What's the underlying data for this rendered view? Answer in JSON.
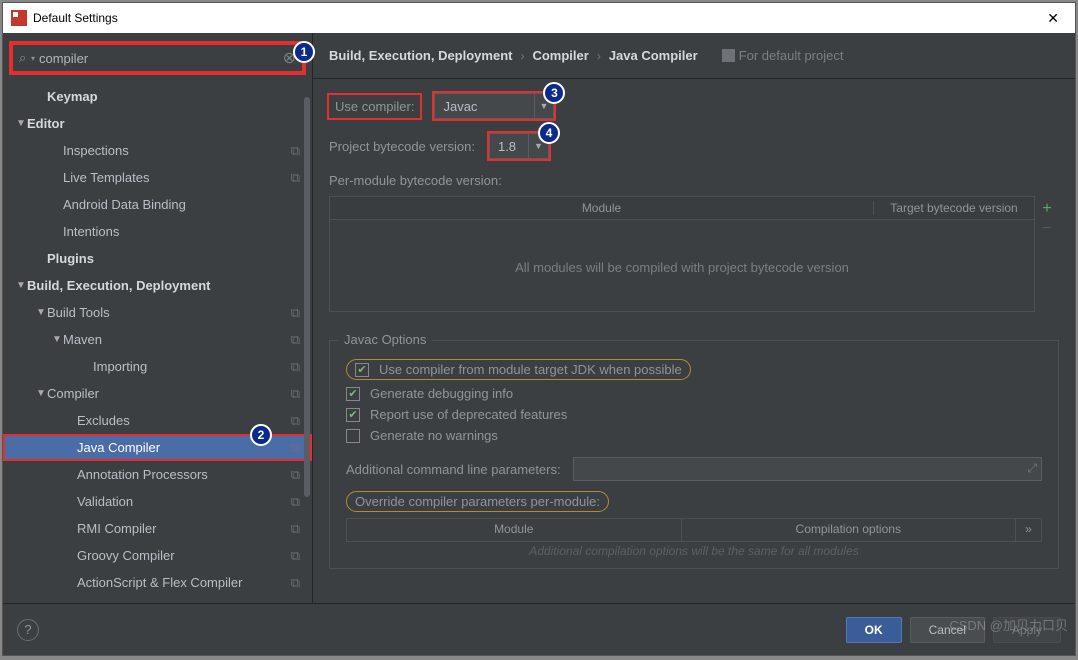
{
  "window": {
    "title": "Default Settings"
  },
  "search": {
    "value": "compiler"
  },
  "annotations": {
    "b1": "1",
    "b2": "2",
    "b3": "3",
    "b4": "4"
  },
  "sidebar": {
    "items": [
      {
        "label": "Keymap",
        "indent": 32,
        "bold": true,
        "arrow": ""
      },
      {
        "label": "Editor",
        "indent": 12,
        "bold": true,
        "arrow": "▼"
      },
      {
        "label": "Inspections",
        "indent": 48,
        "arrow": "",
        "copy": true
      },
      {
        "label": "Live Templates",
        "indent": 48,
        "arrow": "",
        "copy": true
      },
      {
        "label": "Android Data Binding",
        "indent": 48,
        "arrow": ""
      },
      {
        "label": "Intentions",
        "indent": 48,
        "arrow": ""
      },
      {
        "label": "Plugins",
        "indent": 32,
        "bold": true,
        "arrow": ""
      },
      {
        "label": "Build, Execution, Deployment",
        "indent": 12,
        "bold": true,
        "arrow": "▼"
      },
      {
        "label": "Build Tools",
        "indent": 32,
        "arrow": "▼",
        "copy": true
      },
      {
        "label": "Maven",
        "indent": 48,
        "arrow": "▼",
        "copy": true
      },
      {
        "label": "Importing",
        "indent": 78,
        "arrow": "",
        "copy": true
      },
      {
        "label": "Compiler",
        "indent": 32,
        "arrow": "▼",
        "copy": true
      },
      {
        "label": "Excludes",
        "indent": 62,
        "arrow": "",
        "copy": true
      },
      {
        "label": "Java Compiler",
        "indent": 62,
        "arrow": "",
        "copy": true,
        "selected": true,
        "redbox": true
      },
      {
        "label": "Annotation Processors",
        "indent": 62,
        "arrow": "",
        "copy": true
      },
      {
        "label": "Validation",
        "indent": 62,
        "arrow": "",
        "copy": true
      },
      {
        "label": "RMI Compiler",
        "indent": 62,
        "arrow": "",
        "copy": true
      },
      {
        "label": "Groovy Compiler",
        "indent": 62,
        "arrow": "",
        "copy": true
      },
      {
        "label": "ActionScript & Flex Compiler",
        "indent": 62,
        "arrow": "",
        "copy": true
      }
    ]
  },
  "breadcrumb": {
    "a": "Build, Execution, Deployment",
    "b": "Compiler",
    "c": "Java Compiler",
    "fordefault": "For default project"
  },
  "form": {
    "useCompilerLabel": "Use compiler:",
    "useCompilerValue": "Javac",
    "bytecodeLabel": "Project bytecode version:",
    "bytecodeValue": "1.8",
    "perModuleLabel": "Per-module bytecode version:",
    "tableCol1": "Module",
    "tableCol2": "Target bytecode version",
    "tablePlaceholder": "All modules will be compiled with project bytecode version",
    "javacLegend": "Javac Options",
    "chk1": "Use compiler from module target JDK when possible",
    "chk2": "Generate debugging info",
    "chk3": "Report use of deprecated features",
    "chk4": "Generate no warnings",
    "addlLabel": "Additional command line parameters:",
    "overrideLabel": "Override compiler parameters per-module:",
    "subCol1": "Module",
    "subCol2": "Compilation options",
    "subHint": "Additional compilation options will be the same for all modules"
  },
  "footer": {
    "ok": "OK",
    "cancel": "Cancel",
    "apply": "Apply"
  },
  "watermark": "CSDN @加贝力口贝"
}
